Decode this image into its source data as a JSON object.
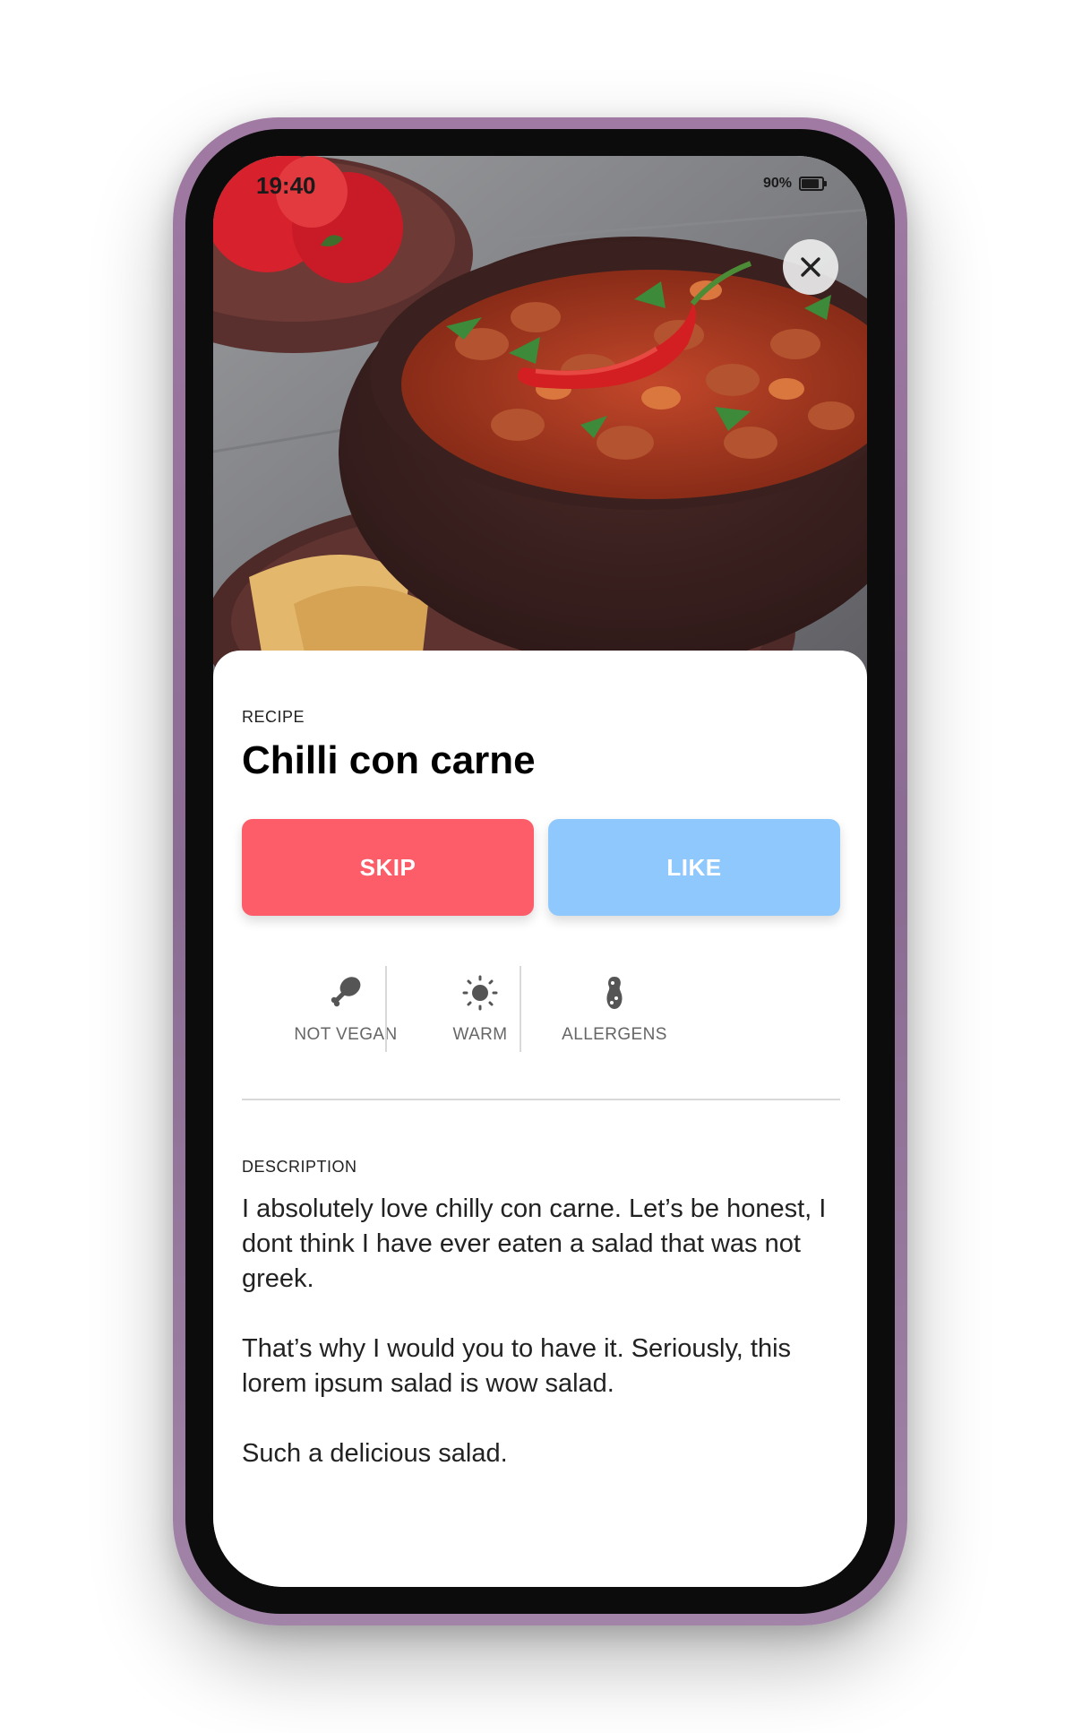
{
  "status_bar": {
    "time": "19:40",
    "battery_percent": "90%"
  },
  "hero": {
    "image_subject": "bowl of chilli con carne with red chilli pepper and tortilla chips",
    "close_icon": "close-icon"
  },
  "recipe": {
    "kicker": "RECIPE",
    "title": "Chilli con carne"
  },
  "actions": {
    "skip_label": "SKIP",
    "like_label": "LIKE",
    "skip_color": "#fd5c69",
    "like_color": "#8fc8fd"
  },
  "attributes": [
    {
      "icon": "drumstick-icon",
      "label": "NOT VEGAN"
    },
    {
      "icon": "sun-icon",
      "label": "WARM"
    },
    {
      "icon": "peanut-icon",
      "label": "ALLERGENS"
    }
  ],
  "description": {
    "heading": "DESCRIPTION",
    "paragraphs": [
      "I absolutely love chilly con carne. Let’s be honest, I dont think I have ever eaten a salad that was not greek.",
      "That’s why I would you to have it. Seriously, this lorem ipsum salad is wow salad.",
      "Such a delicious salad."
    ]
  }
}
